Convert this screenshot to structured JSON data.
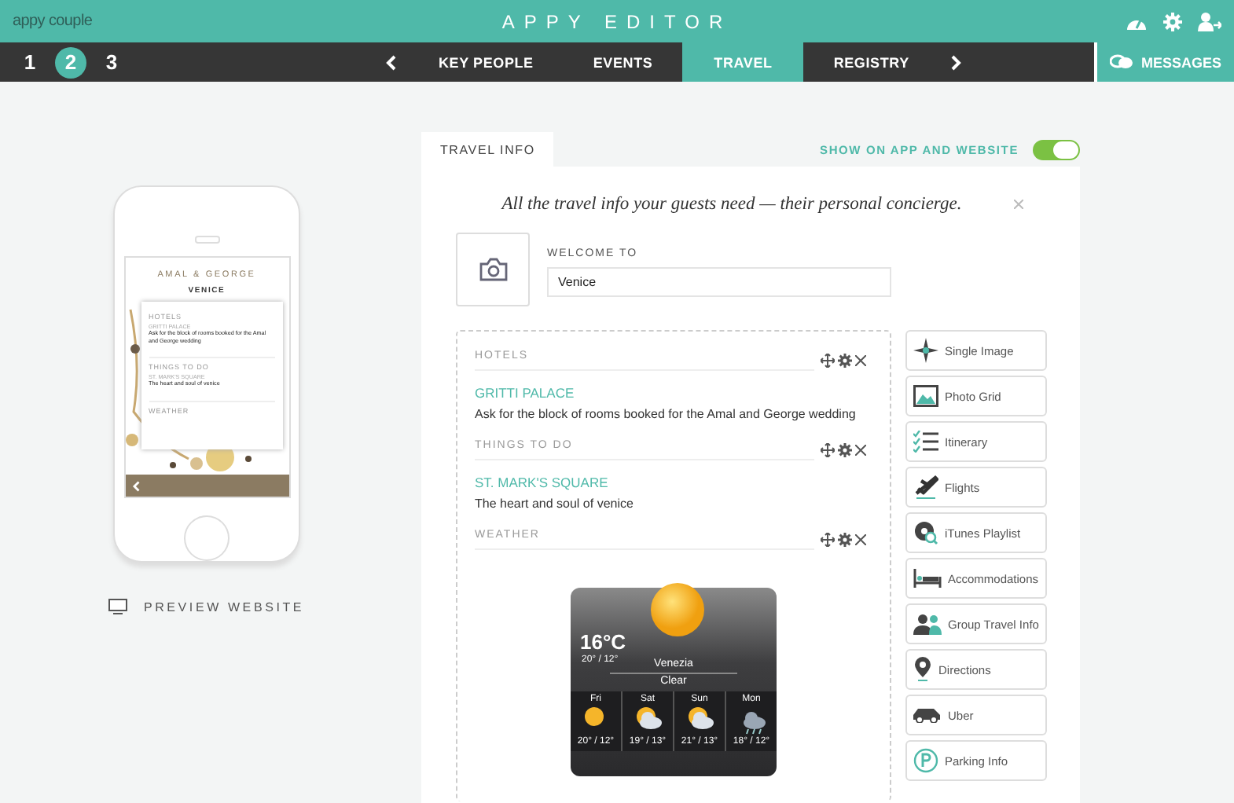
{
  "header": {
    "logo": "appy couple",
    "title": "APPY EDITOR"
  },
  "steps": [
    {
      "label": "1",
      "selected": false
    },
    {
      "label": "2",
      "selected": true
    },
    {
      "label": "3",
      "selected": false
    }
  ],
  "nav_tabs": [
    {
      "label": "KEY PEOPLE",
      "selected": false
    },
    {
      "label": "EVENTS",
      "selected": false
    },
    {
      "label": "TRAVEL",
      "selected": true
    },
    {
      "label": "REGISTRY",
      "selected": false
    }
  ],
  "messages_button": "MESSAGES",
  "phone_preview": {
    "couple": "AMAL & GEORGE",
    "city": "VENICE",
    "sections": [
      {
        "title": "HOTELS",
        "items": [
          {
            "name": "GRITTI PALACE",
            "description": "Ask for the block of rooms booked for the Amal and George wedding"
          }
        ]
      },
      {
        "title": "THINGS TO DO",
        "items": [
          {
            "name": "ST. MARK'S SQUARE",
            "description": "The heart and soul of venice"
          }
        ]
      },
      {
        "title": "WEATHER"
      }
    ]
  },
  "preview_website": "PREVIEW WEBSITE",
  "panel": {
    "tabs": [
      {
        "label": "TRAVEL INFO",
        "selected": true
      }
    ],
    "toggle": {
      "label": "SHOW ON APP AND WEBSITE",
      "on": true
    },
    "intro": "All the travel info your guests need — their personal concierge.",
    "welcome": {
      "label": "WELCOME TO",
      "value": "Venice"
    },
    "sections": [
      {
        "kind": "list",
        "title": "HOTELS",
        "items": [
          {
            "name": "GRITTI PALACE",
            "description": "Ask for the block of rooms booked for the Amal and George wedding"
          }
        ]
      },
      {
        "kind": "list",
        "title": "THINGS TO DO",
        "items": [
          {
            "name": "ST. MARK'S SQUARE",
            "description": "The heart and soul of venice"
          }
        ]
      },
      {
        "kind": "weather",
        "title": "WEATHER",
        "weather": {
          "temperature": "16°C",
          "range": "20° / 12°",
          "city": "Venezia",
          "condition": "Clear",
          "forecast": [
            {
              "day": "Fri",
              "kind": "sunny",
              "range": "20° / 12°"
            },
            {
              "day": "Sat",
              "kind": "partly_cloudy",
              "range": "19° / 13°"
            },
            {
              "day": "Sun",
              "kind": "partly_cloudy",
              "range": "21° / 13°"
            },
            {
              "day": "Mon",
              "kind": "rain",
              "range": "18° / 12°"
            }
          ]
        }
      }
    ],
    "widgets": [
      "Single Image",
      "Photo Grid",
      "Itinerary",
      "Flights",
      "iTunes Playlist",
      "Accommodations",
      "Group Travel Info",
      "Directions",
      "Uber",
      "Parking Info"
    ]
  }
}
